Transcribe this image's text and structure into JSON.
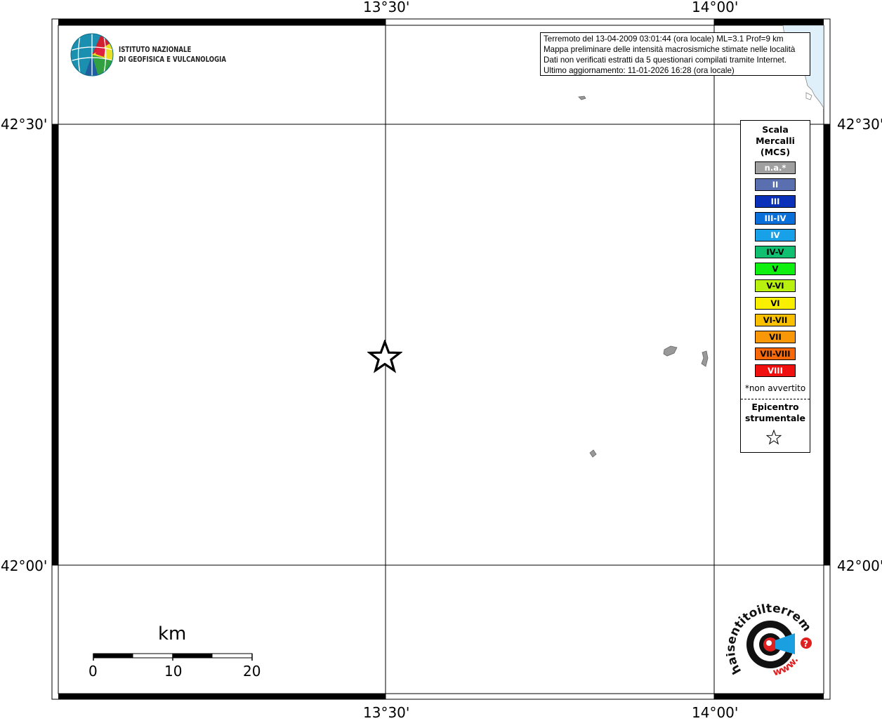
{
  "map": {
    "lon_labels": [
      "13°30'",
      "14°00'"
    ],
    "lat_labels": [
      "42°30'",
      "42°00'"
    ]
  },
  "info": {
    "line1": "Terremoto del 13-04-2009 03:01:44 (ora locale) ML=3.1 Prof=9 km",
    "line2": "Mappa preliminare delle intensità macrosismiche stimate nelle località",
    "line3": "Dati non verificati estratti da 5 questionari compilati tramite Internet.",
    "line4": "Ultimo aggiornamento: 11-01-2026 16:28 (ora locale)"
  },
  "logo": {
    "line1": "ISTITUTO NAZIONALE",
    "line2": "DI GEOFISICA E VULCANOLOGIA",
    "hsit_text": "haisentitoilterremoto.it",
    "hsit_www": "www."
  },
  "legend": {
    "title1": "Scala",
    "title2": "Mercalli",
    "title3": "(MCS)",
    "items": [
      {
        "label": "n.a.*",
        "color": "#a0a0a0"
      },
      {
        "label": "II",
        "color": "#5a6fb0"
      },
      {
        "label": "III",
        "color": "#0a2fb8"
      },
      {
        "label": "III-IV",
        "color": "#0a6fd8"
      },
      {
        "label": "IV",
        "color": "#18a0e8"
      },
      {
        "label": "IV-V",
        "color": "#10c070"
      },
      {
        "label": "V",
        "color": "#10f010"
      },
      {
        "label": "V-VI",
        "color": "#b8f010"
      },
      {
        "label": "VI",
        "color": "#f8f000"
      },
      {
        "label": "VI-VII",
        "color": "#f8c000"
      },
      {
        "label": "VII",
        "color": "#f89808"
      },
      {
        "label": "VII-VIII",
        "color": "#f86808"
      },
      {
        "label": "VIII",
        "color": "#f01010"
      }
    ],
    "not_felt": "*non avvertito",
    "epicenter1": "Epicentro",
    "epicenter2": "strumentale"
  },
  "scale_bar": {
    "unit": "km",
    "ticks": [
      "0",
      "10",
      "20"
    ]
  }
}
